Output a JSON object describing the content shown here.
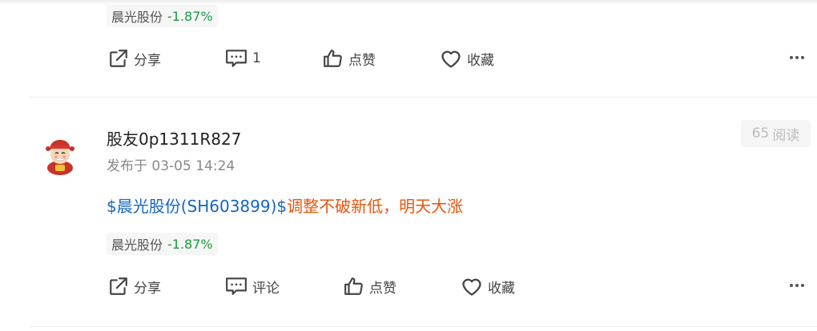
{
  "posts": [
    {
      "stock_tag": {
        "name": "晨光股份",
        "change": "-1.87%"
      },
      "actions": {
        "share": "分享",
        "comment": "1",
        "like": "点赞",
        "favorite": "收藏"
      }
    },
    {
      "author": {
        "name": "股友0p1311R827"
      },
      "time": "发布于 03-05 14:24",
      "read_count": "65",
      "read_label": "阅读",
      "content": {
        "stock_link": "$晨光股份(SH603899)$",
        "text": "调整不破新低，明天大涨"
      },
      "stock_tag": {
        "name": "晨光股份",
        "change": "-1.87%"
      },
      "actions": {
        "share": "分享",
        "comment": "评论",
        "like": "点赞",
        "favorite": "收藏"
      }
    }
  ],
  "colors": {
    "stock_link": "#1565c0",
    "highlight_text": "#e6560c",
    "change_negative": "#1b9a3d"
  },
  "icons": [
    "share-icon",
    "comment-icon",
    "like-icon",
    "favorite-icon",
    "more-icon",
    "avatar"
  ]
}
